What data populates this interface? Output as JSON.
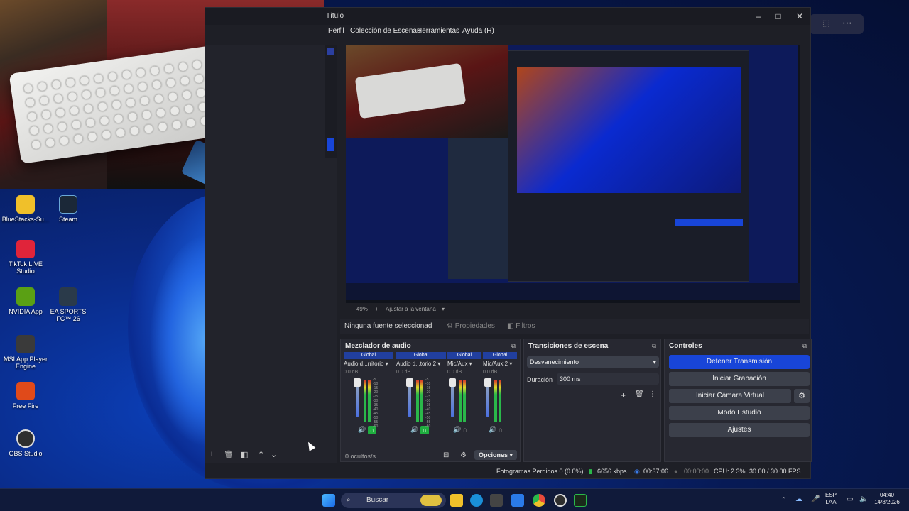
{
  "window": {
    "title": "Título"
  },
  "menu": {
    "perfil": "Perfil",
    "escenas": "Colección de Escenas",
    "herramientas": "Herramientas",
    "ayuda": "Ayuda (H)"
  },
  "window_controls": {
    "minimize": "–",
    "maximize": "□",
    "close": "✕"
  },
  "desktop_icons": [
    {
      "label": "BlueStacks-Su...",
      "color": "#f0c02a"
    },
    {
      "label": "Steam",
      "color": "#1b2838"
    },
    {
      "label": "TikTok LIVE Studio",
      "color": "#e0243a"
    },
    {
      "label": "NVIDIA App",
      "color": "#5aa014"
    },
    {
      "label": "EA SPORTS FC™ 26",
      "color": "#2a3a4a"
    },
    {
      "label": "MSI App Player Engine",
      "color": "#3a3a3a"
    },
    {
      "label": "Free Fire",
      "color": "#e04a1a"
    },
    {
      "label": "OBS Studio",
      "color": "#2e2e2e"
    }
  ],
  "preview_toolbar": {
    "zoom": "49%",
    "fit": "Ajustar a la ventana"
  },
  "source_bar": {
    "no_source": "Ninguna fuente seleccionad",
    "props": "Propiedades",
    "filters": "Filtros"
  },
  "mixer": {
    "title": "Mezclador de audio",
    "channels": [
      {
        "group": "Global",
        "name": "Audio d...rritorio",
        "db": "0.0 dB"
      },
      {
        "group": "Global",
        "name": "Audio d...torio 2",
        "db": "0.0 dB"
      },
      {
        "group": "Global",
        "name": "Mic/Aux",
        "db": "0.0 dB"
      },
      {
        "group": "Global",
        "name": "Mic/Aux 2",
        "db": "0.0 dB"
      }
    ],
    "scale": [
      "-5",
      "-10",
      "-15",
      "-20",
      "-25",
      "-30",
      "-35",
      "-40",
      "-45",
      "-50",
      "-55",
      "-60"
    ],
    "hidden": "0 ocultos/s",
    "options": "Opciones"
  },
  "transitions": {
    "title": "Transiciones de escena",
    "selected": "Desvanecimiento",
    "duration_label": "Duración",
    "duration_value": "300 ms"
  },
  "controls": {
    "title": "Controles",
    "stop_stream": "Detener Transmisión",
    "start_record": "Iniciar Grabación",
    "virtual_cam": "Iniciar Cámara Virtual",
    "studio": "Modo Estudio",
    "settings": "Ajustes"
  },
  "status": {
    "dropped": "Fotogramas Perdidos 0 (0.0%)",
    "bitrate": "6656 kbps",
    "stream_time": "00:37:06",
    "rec_time": "00:00:00",
    "cpu": "CPU: 2.3%",
    "fps": "30.00 / 30.00 FPS"
  },
  "taskbar": {
    "search": "Buscar",
    "lang1": "ESP",
    "lang2": "LAA",
    "time": "04:40",
    "date": "14/8/2026"
  },
  "colors": {
    "accent": "#1845d8",
    "window_bg": "#1e1f26",
    "dock_bg": "#272831"
  }
}
